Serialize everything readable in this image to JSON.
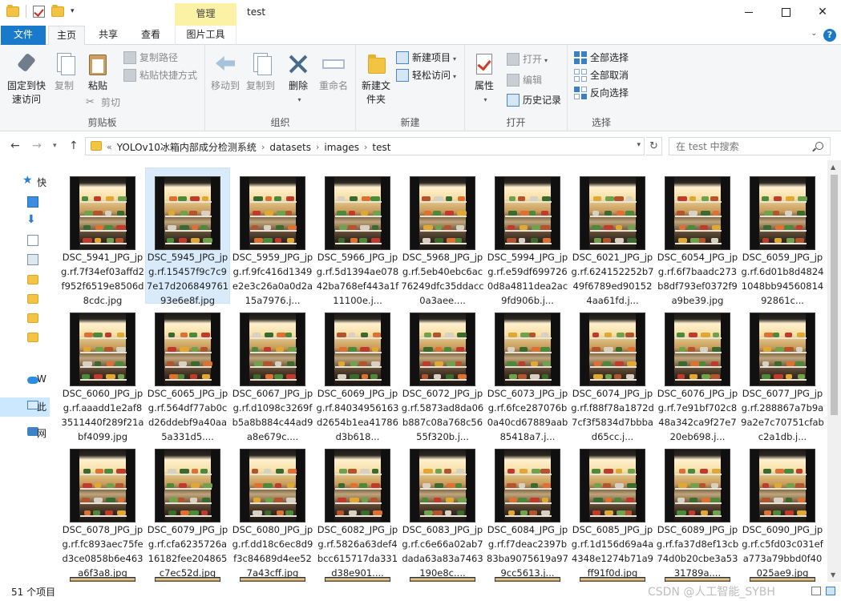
{
  "window": {
    "title": "test",
    "context_tab": "管理"
  },
  "tabs": [
    "文件",
    "主页",
    "共享",
    "查看",
    "图片工具"
  ],
  "ribbon": {
    "clipboard": {
      "label": "剪贴板",
      "pin": "固定到快速访问",
      "copy": "复制",
      "paste": "粘贴",
      "copy_path": "复制路径",
      "paste_shortcut": "粘贴快捷方式",
      "cut": "剪切"
    },
    "organize": {
      "label": "组织",
      "move_to": "移动到",
      "copy_to": "复制到",
      "delete": "删除",
      "rename": "重命名"
    },
    "new": {
      "label": "新建",
      "new_folder": "新建文件夹",
      "new_item": "新建项目",
      "easy_access": "轻松访问"
    },
    "open": {
      "label": "打开",
      "properties": "属性",
      "open": "打开",
      "edit": "编辑",
      "history": "历史记录"
    },
    "select": {
      "label": "选择",
      "select_all": "全部选择",
      "select_none": "全部取消",
      "invert": "反向选择"
    }
  },
  "address": {
    "crumbs": [
      "YOLOv10冰箱内部成分检测系统",
      "datasets",
      "images",
      "test"
    ],
    "search_placeholder": "在 test 中搜索"
  },
  "nav": [
    {
      "label": "快",
      "icon": "star-icon"
    },
    {
      "label": "",
      "icon": "desktop-icon"
    },
    {
      "label": "",
      "icon": "download-icon"
    },
    {
      "label": "",
      "icon": "document-icon"
    },
    {
      "label": "",
      "icon": "picture-icon"
    },
    {
      "label": "",
      "icon": "folder-icon"
    },
    {
      "label": "",
      "icon": "folder-icon"
    },
    {
      "label": "",
      "icon": "folder-icon"
    },
    {
      "label": "",
      "icon": "folder-icon"
    },
    {
      "label": "W",
      "icon": "cloud-icon"
    },
    {
      "label": "此",
      "icon": "pc-icon",
      "selected": true
    },
    {
      "label": "网",
      "icon": "network-icon"
    }
  ],
  "files": [
    [
      "DSC_5941_JPG_jpg.rf.7f34ef03affd2f952f6519e8506d8cdc.jpg",
      "DSC_5945_JPG_jpg.rf.15457f9c7c97e17d20684976193e6e8f.jpg",
      "DSC_5959_JPG_jpg.rf.9fc416d1349e2e3c26a0a0d2a15a7976.j...",
      "DSC_5966_JPG_jpg.rf.5d1394ae07842ba768ef443a1f11100e.j...",
      "DSC_5968_JPG_jpg.rf.5eb40ebc6ac76249dfc35ddacc0a3aee....",
      "DSC_5994_JPG_jpg.rf.e59df6997260d8a4811dea2ac9fd906b.j...",
      "DSC_6021_JPG_jpg.rf.624152252b749f6789ed901524aa61fd.j...",
      "DSC_6054_JPG_jpg.rf.6f7baadc273b8df793ef0372f9a9be39.jpg",
      "DSC_6059_JPG_jpg.rf.6d01b8d48241048bb9456081492861c..."
    ],
    [
      "DSC_6060_JPG_jpg.rf.aaadd1e2af83511440f289f21abf4099.jpg",
      "DSC_6065_JPG_jpg.rf.564df77ab0cd26ddebf9a40aa5a331d5....",
      "DSC_6067_JPG_jpg.rf.d1098c3269fb5a8b884c44ad9a8e679c....",
      "DSC_6069_JPG_jpg.rf.84034956163d2654b1ea41786d3b618...",
      "DSC_6072_JPG_jpg.rf.5873ad8da06b887c08a768c5655f320b.j...",
      "DSC_6073_JPG_jpg.rf.6fce287076b0a40cd67889aab85418a7.j...",
      "DSC_6074_JPG_jpg.rf.f88f78a1872d7cf3f5834d7bbbad65cc.j...",
      "DSC_6076_JPG_jpg.rf.7e91bf702c848a342ca9f27e720eb698.j...",
      "DSC_6077_JPG_jpg.rf.288867a7b9a9a2e7c70751cfabc2a1db.j..."
    ],
    [
      "DSC_6078_JPG_jpg.rf.fc893aec75fed3ce0858b6e463a6f3a8.jpg",
      "DSC_6079_JPG_jpg.rf.cfa6235726a16182fee204865c7ec52d.jpg",
      "DSC_6080_JPG_jpg.rf.dd18c6ec8d9f3c84689d4ee527a43cff.jpg",
      "DSC_6082_JPG_jpg.rf.5826a63def4bcc615717da331d38e901....",
      "DSC_6083_JPG_jpg.rf.c6e66a02ab7dada63a83a7463190e8c....",
      "DSC_6084_JPG_jpg.rf.f7deac2397b83ba9075619a979cc5613.j...",
      "DSC_6085_JPG_jpg.rf.1d156d69a4a4348e1274b71a9ff91f0d.jpg",
      "DSC_6089_JPG_jpg.rf.fa37d8ef13cb74d0b20cbe3a5331789a....",
      "DSC_6090_JPG_jpg.rf.c5fd03c031efa773a79bbd0f40025ae9.jpg"
    ]
  ],
  "selected_file": "DSC_5945_JPG_jpg.rf.15457f9c7c97e17d20684976193e6e8f.jpg",
  "status": {
    "count": "51 个项目",
    "watermark": "CSDN @人工智能_SYBH"
  },
  "colors": {
    "file_tab": "#1979ca",
    "context_tab": "#fbf2a5",
    "selection": "#d9ebfb"
  }
}
